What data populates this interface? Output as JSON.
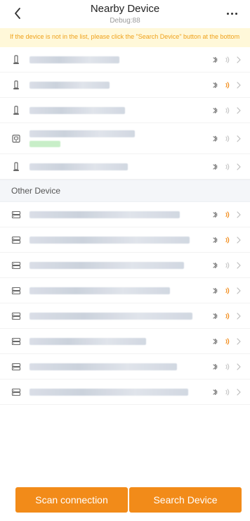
{
  "header": {
    "title": "Nearby Device",
    "subtitle": "Debug:88"
  },
  "notice": {
    "text": "If the device is not in the list, please click the \"Search Device\" button at the bottom"
  },
  "nearby": [
    {
      "name": "",
      "icon": "lock-icon",
      "signal": "gray",
      "has_tag": false
    },
    {
      "name": "",
      "icon": "lock-icon",
      "signal": "orange",
      "has_tag": false
    },
    {
      "name": "",
      "icon": "lock-icon",
      "signal": "gray",
      "has_tag": false
    },
    {
      "name": "",
      "icon": "device-icon",
      "signal": "gray",
      "has_tag": true
    },
    {
      "name": "",
      "icon": "lock-icon",
      "signal": "gray",
      "has_tag": false
    }
  ],
  "other_section": {
    "title": "Other Device"
  },
  "other": [
    {
      "name": "",
      "icon": "server-icon",
      "signal": "orange"
    },
    {
      "name": "",
      "icon": "server-icon",
      "signal": "orange"
    },
    {
      "name": "",
      "icon": "server-icon",
      "signal": "gray"
    },
    {
      "name": "",
      "icon": "server-icon",
      "signal": "orange"
    },
    {
      "name": "",
      "icon": "server-icon",
      "signal": "orange"
    },
    {
      "name": "",
      "icon": "server-icon",
      "signal": "orange"
    },
    {
      "name": "",
      "icon": "server-icon",
      "signal": "gray"
    },
    {
      "name": "",
      "icon": "server-icon",
      "signal": "gray"
    }
  ],
  "actions": {
    "scan_label": "Scan connection",
    "search_label": "Search Device"
  },
  "colors": {
    "accent": "#f28b19",
    "notice_bg": "#fff8d9",
    "notice_text": "#efa11a",
    "signal_orange": "#f28b19",
    "signal_gray": "#c7c7c7"
  }
}
